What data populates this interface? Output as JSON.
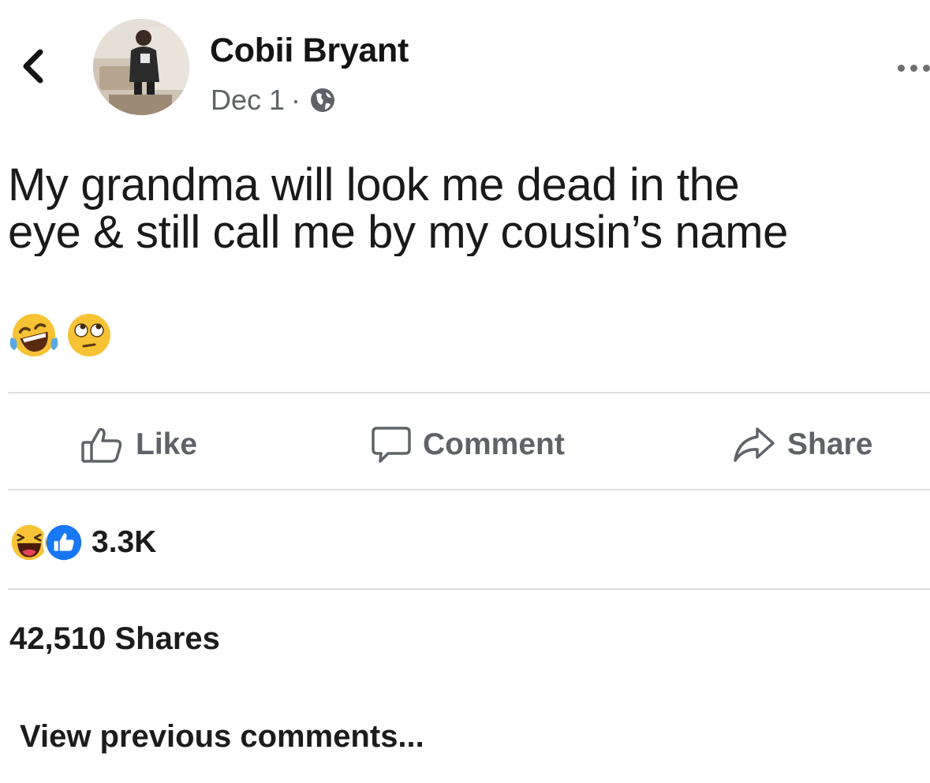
{
  "post": {
    "author": "Cobii Bryant",
    "date": "Dec 1",
    "separator": "·",
    "privacy_icon": "globe-icon",
    "text": "My grandma will look me dead in the\neye & still call me by my cousin’s name",
    "emojis": [
      "face-with-tears-of-joy-emoji",
      "face-with-rolling-eyes-emoji"
    ]
  },
  "header": {
    "back_icon": "chevron-left-icon",
    "more_icon": "more-dots-icon"
  },
  "actions": {
    "like_label": "Like",
    "comment_label": "Comment",
    "share_label": "Share"
  },
  "reactions": {
    "icons": [
      "haha-reaction-icon",
      "like-reaction-icon"
    ],
    "count": "3.3K"
  },
  "stats": {
    "shares": "42,510 Shares"
  },
  "comments": {
    "view_previous": "View previous comments..."
  },
  "colors": {
    "text": "#1a1a1a",
    "muted": "#5f6368",
    "divider": "#dddddd",
    "like_blue": "#1877f2",
    "emoji_yellow": "#f7c234"
  }
}
